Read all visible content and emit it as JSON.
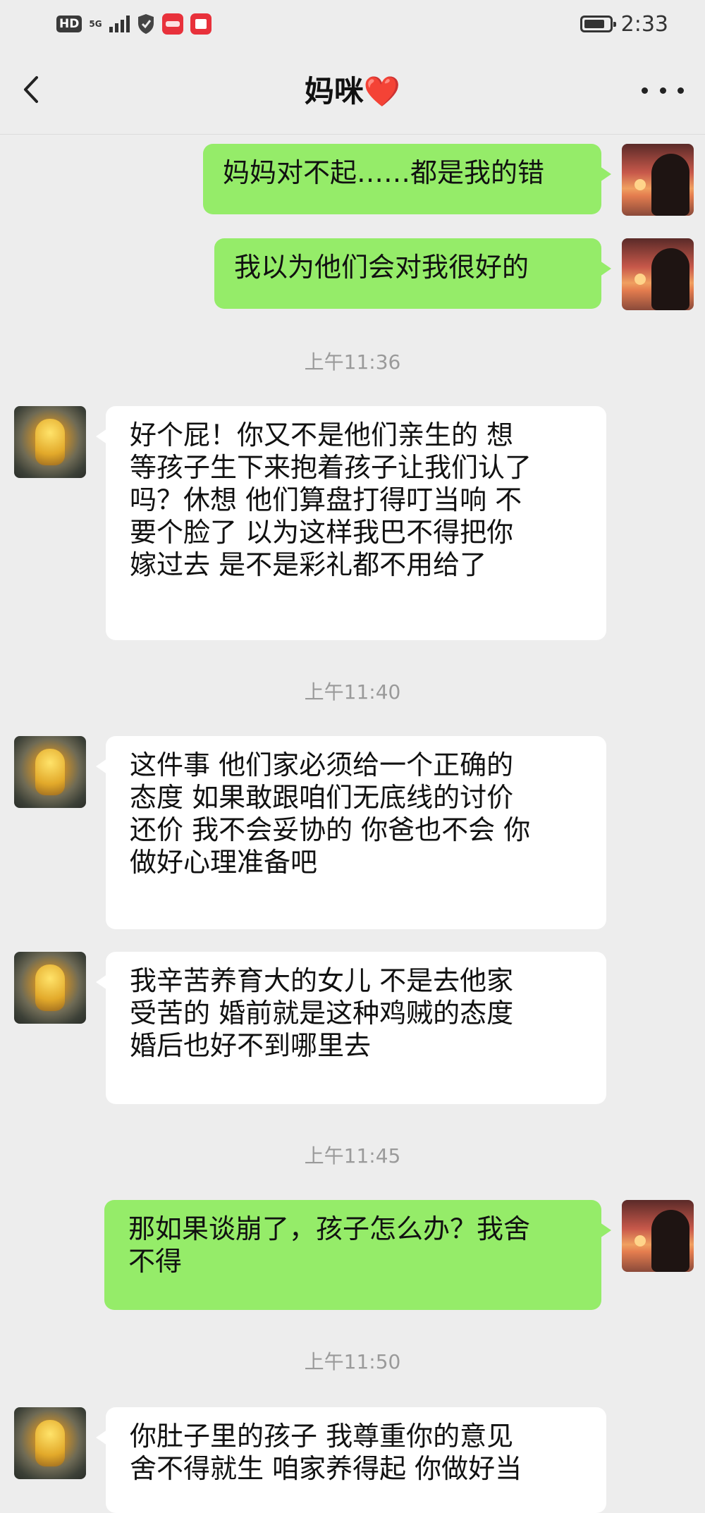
{
  "status_bar": {
    "hd": "HD",
    "network": "5G",
    "time": "2:33"
  },
  "header": {
    "title": "妈咪",
    "title_emoji": "❤️"
  },
  "messages": [
    {
      "sender": "me",
      "text": "妈妈对不起……都是我的错"
    },
    {
      "sender": "me",
      "text": "我以为他们会对我很好的"
    },
    {
      "type": "time",
      "text": "上午11:36"
    },
    {
      "sender": "mom",
      "text": "好个屁！你又不是他们亲生的 想\n等孩子生下来抱着孩子让我们认了\n吗？休想 他们算盘打得叮当响 不\n要个脸了 以为这样我巴不得把你\n嫁过去 是不是彩礼都不用给了"
    },
    {
      "type": "time",
      "text": "上午11:40"
    },
    {
      "sender": "mom",
      "text": "这件事 他们家必须给一个正确的\n态度 如果敢跟咱们无底线的讨价\n还价 我不会妥协的 你爸也不会 你\n做好心理准备吧"
    },
    {
      "sender": "mom",
      "text": "我辛苦养育大的女儿 不是去他家\n受苦的 婚前就是这种鸡贼的态度\n婚后也好不到哪里去"
    },
    {
      "type": "time",
      "text": "上午11:45"
    },
    {
      "sender": "me",
      "text": "那如果谈崩了，孩子怎么办？我舍\n不得"
    },
    {
      "type": "time",
      "text": "上午11:50"
    },
    {
      "sender": "mom",
      "text": "你肚子里的孩子 我尊重你的意见\n舍不得就生 咱家养得起 你做好当"
    }
  ],
  "colors": {
    "background": "#ededed",
    "my_bubble": "#95ec69",
    "other_bubble": "#ffffff",
    "heart": "#e21b2c"
  },
  "icons": [
    "back-icon",
    "more-icon",
    "battery-icon",
    "signal-icon",
    "shield-icon"
  ]
}
